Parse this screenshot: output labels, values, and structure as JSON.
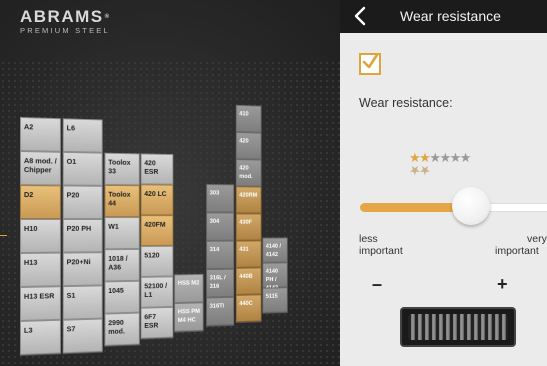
{
  "logo": {
    "brand": "ABRAMS",
    "reg": "®",
    "sub": "PREMIUM STEEL"
  },
  "header": {
    "title": "Wear resistance"
  },
  "panel": {
    "checkbox_checked": true,
    "label": "Wear resistance:",
    "rating": {
      "filled": 2,
      "total": 6
    },
    "slider_value_fraction": 0.55,
    "less_label": [
      "less",
      "important"
    ],
    "very_label": [
      "very",
      "important"
    ],
    "minus": "–",
    "plus": "+"
  },
  "colors": {
    "accent": "#e3a540",
    "topbar": "#1b1b1b"
  },
  "tiles": [
    {
      "label": "A2"
    },
    {
      "label": "L6"
    },
    {
      "label": "A8 mod. / Chipper"
    },
    {
      "label": "O1"
    },
    {
      "label": "Toolox 33"
    },
    {
      "label": "420 ESR"
    },
    {
      "label": "D2"
    },
    {
      "label": "P20"
    },
    {
      "label": "Toolox 44"
    },
    {
      "label": "420 LC"
    },
    {
      "label": "H10"
    },
    {
      "label": "P20 PH"
    },
    {
      "label": "W1"
    },
    {
      "label": "420FM"
    },
    {
      "label": "H13"
    },
    {
      "label": "P20+Ni"
    },
    {
      "label": "1018 / A36"
    },
    {
      "label": "5120"
    },
    {
      "label": "H13 ESR"
    },
    {
      "label": "S1"
    },
    {
      "label": "1045"
    },
    {
      "label": "52100 / L1"
    },
    {
      "label": "HSS M2"
    },
    {
      "label": "L3"
    },
    {
      "label": "S7"
    },
    {
      "label": "2990 mod."
    },
    {
      "label": "6F7 ESR"
    },
    {
      "label": "HSS PM M4 HC"
    },
    {
      "label": "410"
    },
    {
      "label": "420"
    },
    {
      "label": "420 mod."
    },
    {
      "label": "303"
    },
    {
      "label": "420RM"
    },
    {
      "label": "304"
    },
    {
      "label": "430F"
    },
    {
      "label": "314"
    },
    {
      "label": "431"
    },
    {
      "label": "4140 / 4142"
    },
    {
      "label": "316L / 316"
    },
    {
      "label": "440B"
    },
    {
      "label": "4140 PH / 4142 PH"
    },
    {
      "label": "316Ti"
    },
    {
      "label": "440C"
    },
    {
      "label": "5115"
    }
  ]
}
